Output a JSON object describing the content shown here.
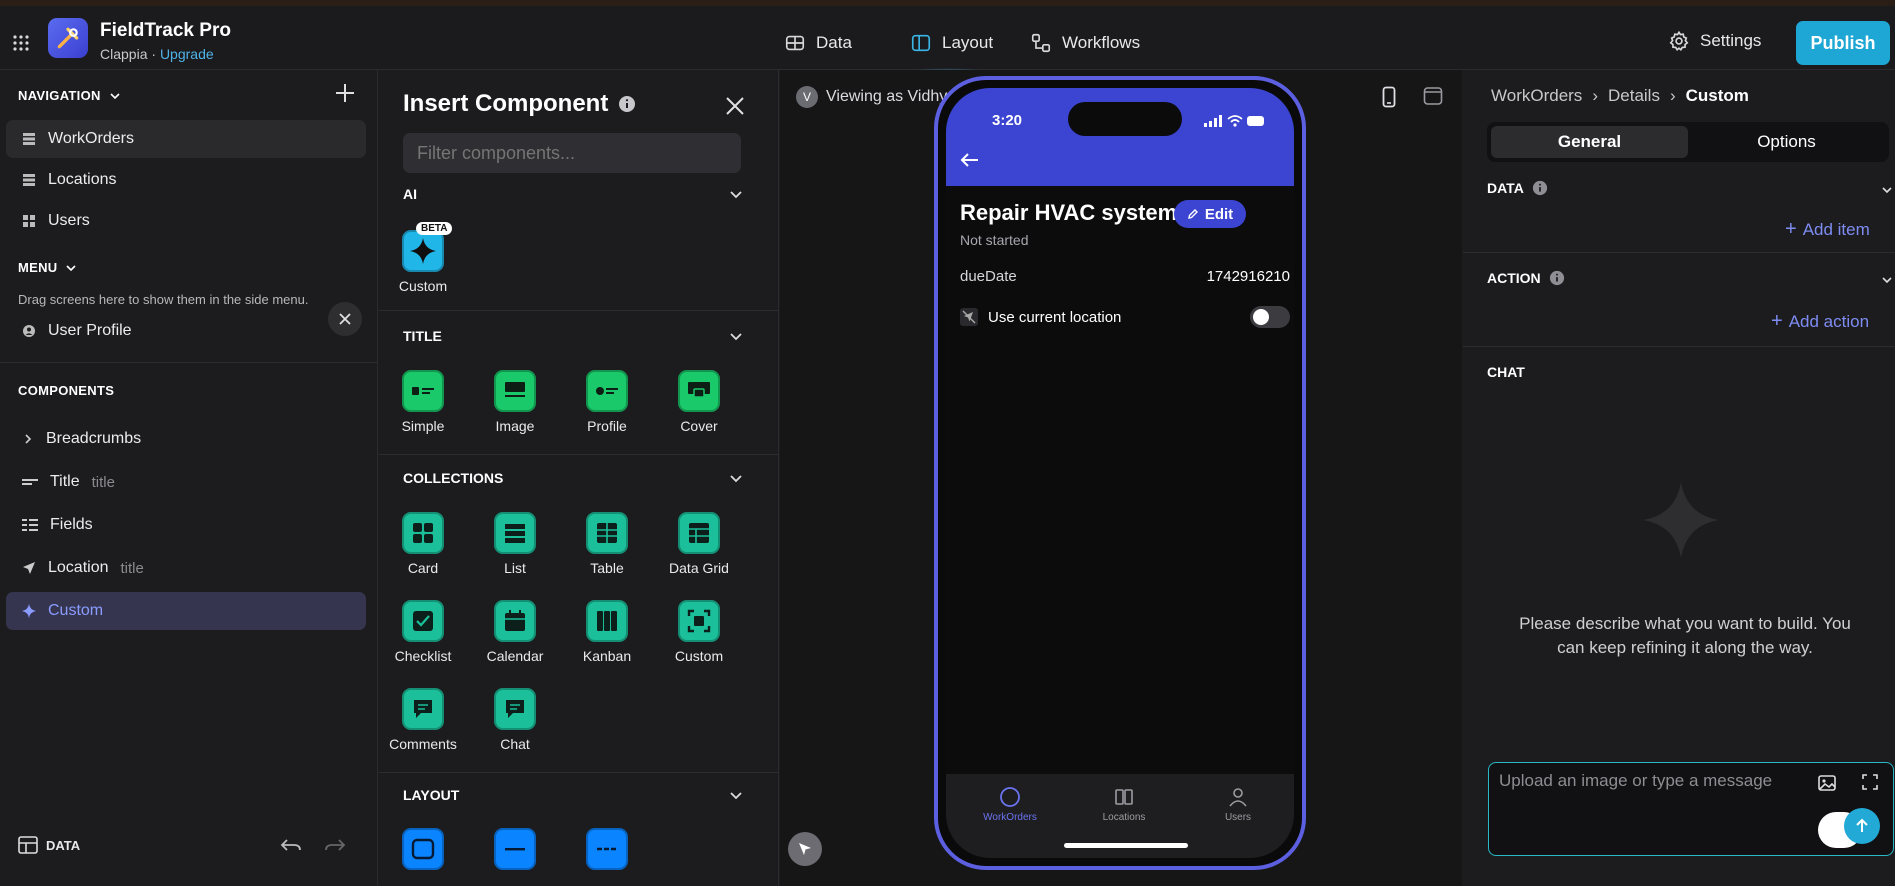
{
  "header": {
    "app_name": "FieldTrack Pro",
    "org": "Clappia",
    "separator": "·",
    "upgrade": "Upgrade",
    "tabs": [
      {
        "label": "Data",
        "icon": "database-icon"
      },
      {
        "label": "Layout",
        "icon": "layout-icon"
      },
      {
        "label": "Workflows",
        "icon": "workflow-icon"
      }
    ],
    "settings": "Settings",
    "publish": "Publish"
  },
  "sidebar": {
    "navigation_title": "NAVIGATION",
    "nav_items": [
      {
        "label": "WorkOrders"
      },
      {
        "label": "Locations"
      },
      {
        "label": "Users"
      }
    ],
    "menu_title": "MENU",
    "menu_hint": "Drag screens here to show them in the side menu.",
    "menu_items": [
      {
        "label": "User Profile"
      }
    ],
    "components_title": "COMPONENTS",
    "components": [
      {
        "label": "Breadcrumbs",
        "sub": ""
      },
      {
        "label": "Title",
        "sub": "title"
      },
      {
        "label": "Fields",
        "sub": ""
      },
      {
        "label": "Location",
        "sub": "title"
      },
      {
        "label": "Custom",
        "sub": ""
      }
    ],
    "footer_data": "DATA"
  },
  "insert": {
    "title": "Insert Component",
    "filter_placeholder": "Filter components...",
    "ai_title": "AI",
    "ai_items": [
      {
        "label": "Custom",
        "badge": "BETA"
      }
    ],
    "title_section": "TITLE",
    "title_items": [
      {
        "label": "Simple"
      },
      {
        "label": "Image"
      },
      {
        "label": "Profile"
      },
      {
        "label": "Cover"
      }
    ],
    "collections_section": "COLLECTIONS",
    "collections_items": [
      {
        "label": "Card"
      },
      {
        "label": "List"
      },
      {
        "label": "Table"
      },
      {
        "label": "Data Grid"
      },
      {
        "label": "Checklist"
      },
      {
        "label": "Calendar"
      },
      {
        "label": "Kanban"
      },
      {
        "label": "Custom"
      },
      {
        "label": "Comments"
      },
      {
        "label": "Chat"
      }
    ],
    "layout_section": "LAYOUT"
  },
  "canvas": {
    "viewing_initial": "V",
    "viewing_as": "Viewing as Vidhy"
  },
  "phone": {
    "time": "3:20",
    "title": "Repair HVAC system",
    "status": "Not started",
    "edit": "Edit",
    "field_label": "dueDate",
    "field_value": "1742916210",
    "toggle_label": "Use current location",
    "toggle_on": false,
    "tabs": [
      {
        "label": "WorkOrders"
      },
      {
        "label": "Locations"
      },
      {
        "label": "Users"
      }
    ]
  },
  "right": {
    "breadcrumb": [
      "WorkOrders",
      "Details",
      "Custom"
    ],
    "seg_general": "General",
    "seg_options": "Options",
    "data_title": "DATA",
    "add_item": "Add item",
    "action_title": "ACTION",
    "add_action": "Add action",
    "chat_title": "CHAT",
    "chat_message": "Please describe what you want to build. You can keep refining it along the way.",
    "chat_placeholder": "Upload an image or type a message"
  },
  "colors": {
    "accent_blue": "#1ea7d4",
    "phone_header": "#3c45d1",
    "component_green": "#19c96a",
    "link_purple": "#7e8cf2"
  }
}
